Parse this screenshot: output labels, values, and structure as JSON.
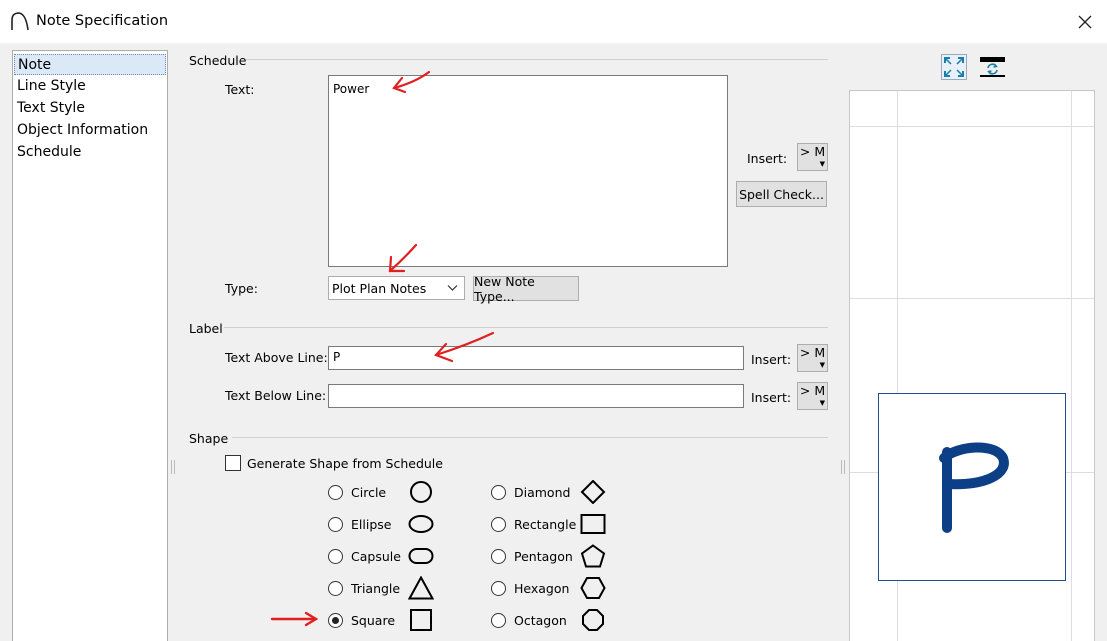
{
  "window": {
    "title": "Note Specification"
  },
  "nav": {
    "items": [
      "Note",
      "Line Style",
      "Text Style",
      "Object Information",
      "Schedule"
    ],
    "selected": 0
  },
  "schedule": {
    "group_label": "Schedule",
    "text_label": "Text:",
    "text_value": "Power",
    "insert_label": "Insert:",
    "insert_button": "> M",
    "spell_check": "Spell Check...",
    "type_label": "Type:",
    "type_value": "Plot Plan Notes",
    "new_note_type": "New Note Type..."
  },
  "label": {
    "group_label": "Label",
    "above_label": "Text Above Line:",
    "above_value": "P",
    "below_label": "Text Below Line:",
    "below_value": "",
    "insert_label": "Insert:",
    "insert_button": "> M"
  },
  "shape": {
    "group_label": "Shape",
    "generate_label": "Generate Shape from Schedule",
    "generate_checked": false,
    "left_options": [
      "Circle",
      "Ellipse",
      "Capsule",
      "Triangle",
      "Square"
    ],
    "right_options": [
      "Diamond",
      "Rectangle",
      "Pentagon",
      "Hexagon",
      "Octagon"
    ],
    "selected": "Square"
  },
  "preview": {
    "glyph": "P",
    "glyph_color": "#0c3f86"
  },
  "colors": {
    "annotation_arrow": "#e02020",
    "selection": "#dbe8f7"
  },
  "icons": {
    "fit": "fit-to-window-icon",
    "refresh": "refresh-preview-icon"
  }
}
